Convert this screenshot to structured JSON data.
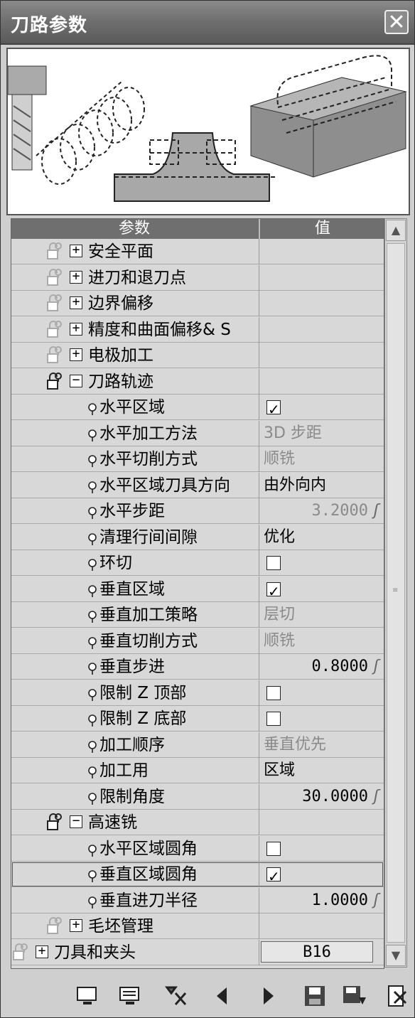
{
  "window": {
    "title": "刀路参数",
    "close_symbol": "✕"
  },
  "grid": {
    "header_param": "参数",
    "header_value": "值",
    "rows": [
      {
        "label": "安全平面",
        "value": ""
      },
      {
        "label": "进刀和退刀点",
        "value": ""
      },
      {
        "label": "边界偏移",
        "value": ""
      },
      {
        "label": "精度和曲面偏移& S",
        "value": ""
      },
      {
        "label": "电极加工",
        "value": ""
      },
      {
        "label": "刀路轨迹",
        "value": ""
      },
      {
        "label": "水平区域",
        "value": ""
      },
      {
        "label": "水平加工方法",
        "value": "3D 步距"
      },
      {
        "label": "水平切削方式",
        "value": "顺铣"
      },
      {
        "label": "水平区域刀具方向",
        "value": "由外向内"
      },
      {
        "label": "水平步距",
        "value": "3.2000"
      },
      {
        "label": "清理行间间隙",
        "value": "优化"
      },
      {
        "label": "环切",
        "value": ""
      },
      {
        "label": "垂直区域",
        "value": ""
      },
      {
        "label": "垂直加工策略",
        "value": "层切"
      },
      {
        "label": "垂直切削方式",
        "value": "顺铣"
      },
      {
        "label": "垂直步进",
        "value": "0.8000"
      },
      {
        "label": "限制 Z 顶部",
        "value": ""
      },
      {
        "label": "限制 Z 底部",
        "value": ""
      },
      {
        "label": "加工顺序",
        "value": "垂直优先"
      },
      {
        "label": "加工用",
        "value": "区域"
      },
      {
        "label": "限制角度",
        "value": "30.0000"
      },
      {
        "label": "高速铣",
        "value": ""
      },
      {
        "label": "水平区域圆角",
        "value": ""
      },
      {
        "label": "垂直区域圆角",
        "value": ""
      },
      {
        "label": "垂直进刀半径",
        "value": "1.0000"
      },
      {
        "label": "毛坯管理",
        "value": ""
      },
      {
        "label": "刀具和夹头",
        "value": "B16"
      }
    ],
    "checkboxes": {
      "水平区域": true,
      "环切": false,
      "垂直区域": true,
      "限制 Z 顶部": false,
      "限制 Z 底部": false,
      "水平区域圆角": false,
      "垂直区域圆角": true
    }
  },
  "icons": {
    "expand": "⊞",
    "collapse": "⊟",
    "function_symbol": "ʃ",
    "toolbar": [
      "monitor-icon",
      "monitor-list-icon",
      "filter-tool-icon",
      "previous-icon",
      "next-icon",
      "save-icon",
      "save-load-icon",
      "exit-icon"
    ]
  },
  "symbols": {
    "plus": "+",
    "minus": "−",
    "prev": "◀",
    "next": "▶",
    "scroll_up": "▲",
    "scroll_down": "▼"
  }
}
